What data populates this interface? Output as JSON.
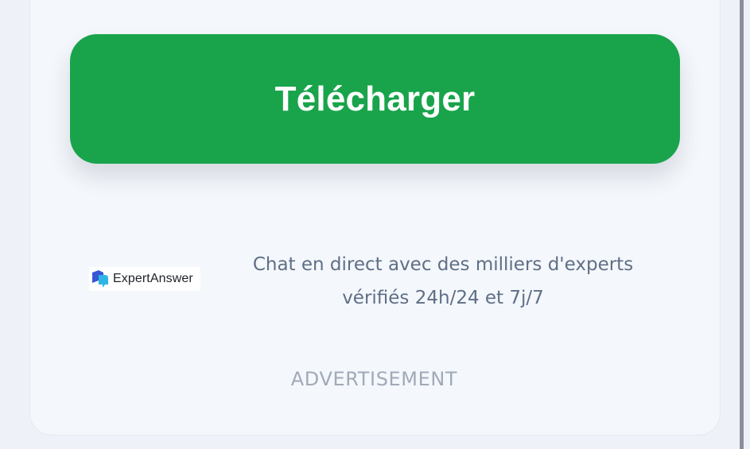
{
  "download_button": {
    "label": "Télécharger",
    "color": "#19a44b"
  },
  "advertisement": {
    "logo": {
      "icon": "expertanswer-logo-icon",
      "name": "ExpertAnswer"
    },
    "text": "Chat en direct avec des milliers d'experts vérifiés 24h/24 et 7j/7",
    "label": "ADVERTISEMENT"
  }
}
